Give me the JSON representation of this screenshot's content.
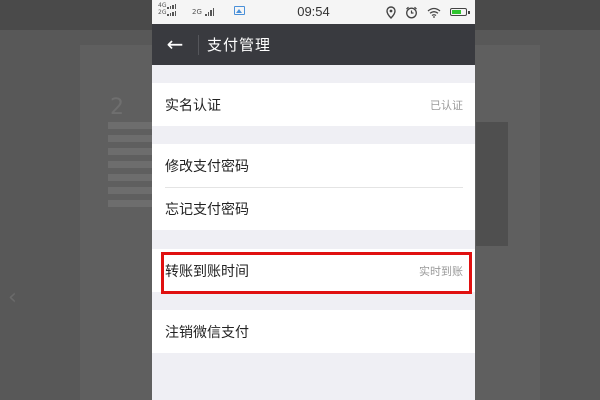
{
  "status_bar": {
    "signal1_label": "4G",
    "signal1_sub": "2G",
    "signal2_label": "2G",
    "time": "09:54",
    "icons": [
      "location-icon",
      "alarm-icon",
      "wifi-icon",
      "battery-icon"
    ]
  },
  "nav": {
    "back_glyph": "←",
    "title": "支付管理"
  },
  "groups": [
    {
      "items": [
        {
          "label": "实名认证",
          "value": "已认证"
        }
      ]
    },
    {
      "items": [
        {
          "label": "修改支付密码",
          "value": ""
        },
        {
          "label": "忘记支付密码",
          "value": ""
        }
      ]
    },
    {
      "items": [
        {
          "label": "转账到账时间",
          "value": "实时到账"
        }
      ]
    },
    {
      "items": [
        {
          "label": "注销微信支付",
          "value": ""
        }
      ]
    }
  ],
  "background": {
    "number": "2"
  },
  "colors": {
    "nav_bg": "#393a3f",
    "page_bg": "#efeff4",
    "highlight": "#e01010",
    "battery": "#2fc52f"
  }
}
